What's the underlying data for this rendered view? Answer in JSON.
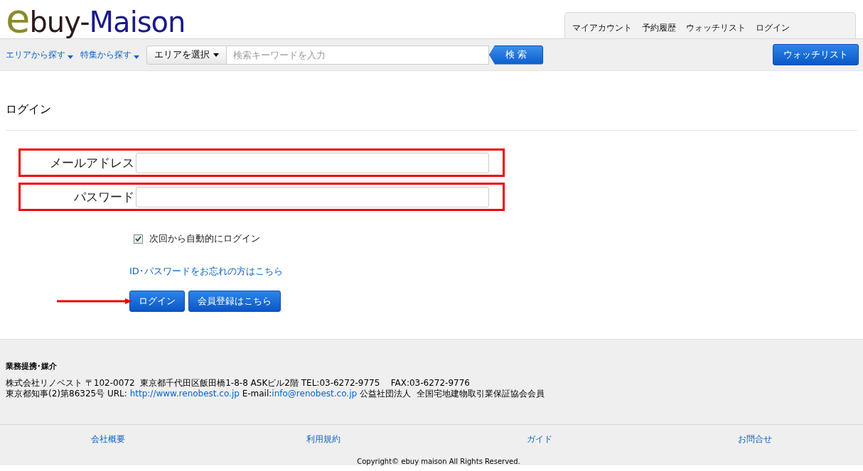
{
  "logo": {
    "parts": [
      "e",
      "buy-",
      "Maison"
    ]
  },
  "top_menu": [
    "マイアカウント",
    "予約履歴",
    "ウォッチリスト",
    "ログイン"
  ],
  "nav": {
    "dropdowns": [
      "エリアから探す",
      "特集から探す"
    ],
    "area_select": "エリアを選択",
    "search": {
      "placeholder": "検索キーワードを入力"
    },
    "search_button": "検 索",
    "watchlist_button": "ウォッチリスト"
  },
  "page_title": "ログイン",
  "form": {
    "fields": [
      {
        "label": "メールアドレス"
      },
      {
        "label": "パスワード"
      }
    ],
    "remember": {
      "label": "次回から自動的にログイン",
      "checked": true
    },
    "forgot_link": "ID･パスワードをお忘れの方はこちら",
    "buttons": [
      "ログイン",
      "会員登録はこちら"
    ]
  },
  "footer": {
    "heading": "業務提携･媒介",
    "line_1": "株式会社リノベスト 〒102-0072  東京都千代田区飯田橋1-8-8 ASKビル2階 TEL:03-6272-9775    FAX:03-6272-9776",
    "line_2": [
      {
        "text": "東京都知事(2)第86325号 URL: ",
        "link": false
      },
      {
        "text": "http://www.renobest.co.jp",
        "link": true
      },
      {
        "text": " E-mail:",
        "link": false
      },
      {
        "text": "info@renobest.co.jp",
        "link": true
      },
      {
        "text": " 公益社団法人  全国宅地建物取引業保証協会会員",
        "link": false
      }
    ],
    "links": [
      "会社概要",
      "利用規約",
      "ガイド",
      "お問合せ"
    ],
    "copyright": "Copyright© ebuy maison All Rights Reserved."
  }
}
